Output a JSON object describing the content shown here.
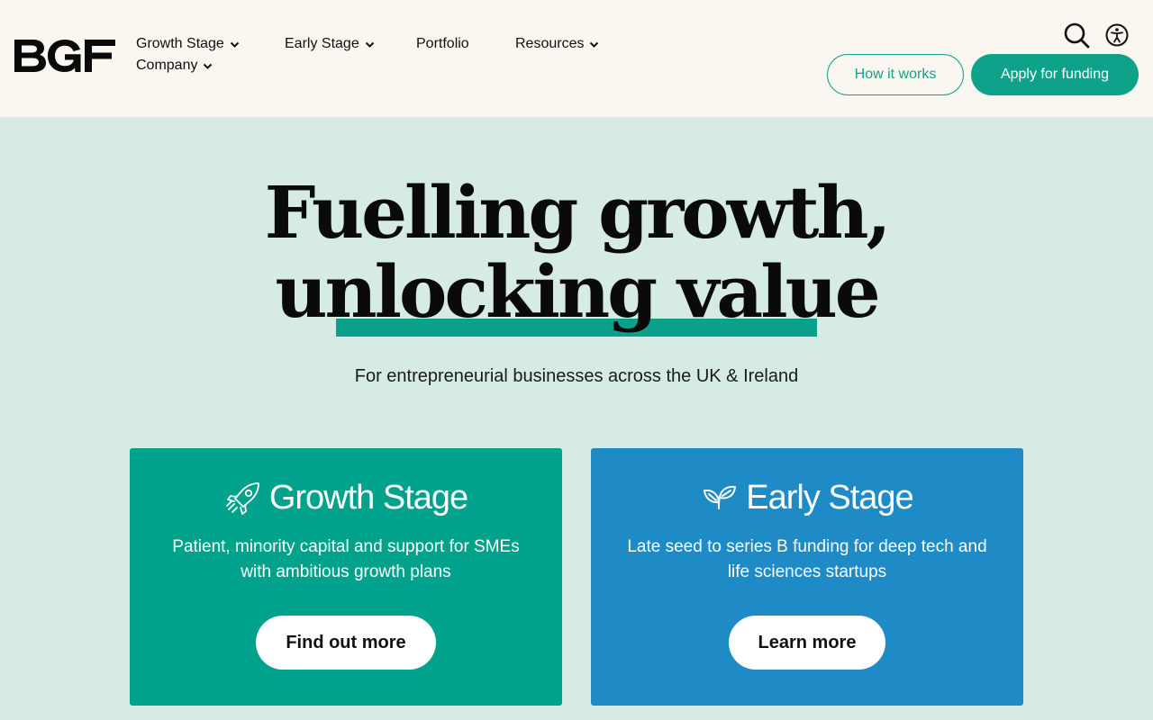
{
  "brand": {
    "logo_text": "BGF"
  },
  "nav": {
    "items": [
      {
        "label": "Growth Stage",
        "has_dropdown": true
      },
      {
        "label": "Early Stage",
        "has_dropdown": true
      },
      {
        "label": "Portfolio",
        "has_dropdown": false
      },
      {
        "label": "Resources",
        "has_dropdown": true
      },
      {
        "label": "Company",
        "has_dropdown": true
      }
    ]
  },
  "header_actions": {
    "icons": [
      "search-icon",
      "accessibility-icon"
    ],
    "how_it_works_label": "How it works",
    "apply_label": "Apply for funding"
  },
  "hero": {
    "title_line1": "Fuelling growth,",
    "title_line2": "unlocking value",
    "subtitle": "For entrepreneurial businesses across the UK & Ireland"
  },
  "cards": [
    {
      "title": "Growth Stage",
      "icon": "rocket-icon",
      "description": "Patient, minority capital and support for SMEs with ambitious growth plans",
      "button_label": "Find out more",
      "color": "#00a28c"
    },
    {
      "title": "Early Stage",
      "icon": "seedling-icon",
      "description": "Late seed to series B funding for deep tech and life sciences startups",
      "button_label": "Learn more",
      "color": "#1e8ac6"
    }
  ],
  "colors": {
    "header_bg": "#faf6f0",
    "page_bg": "#d6ebe3",
    "accent_green": "#0fa28b",
    "accent_blue": "#1e8ac6"
  }
}
